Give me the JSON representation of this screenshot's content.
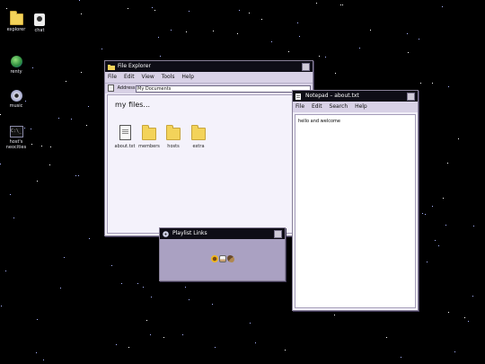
{
  "desktop": {
    "background": "#000000",
    "icons": [
      {
        "label": "explorer",
        "icon": "folder-icon"
      },
      {
        "label": "chat",
        "icon": "chat-icon"
      },
      {
        "label": "renty",
        "icon": "globe-icon"
      },
      {
        "label": "music",
        "icon": "cd-icon"
      },
      {
        "label": "host's neocities",
        "icon": "terminal-icon"
      }
    ]
  },
  "explorer": {
    "title": "File Explorer",
    "menu": [
      "File",
      "Edit",
      "View",
      "Tools",
      "Help"
    ],
    "address_label": "Address",
    "address_value": "My Documents",
    "heading": "my files...",
    "files": [
      {
        "name": "about.txt",
        "icon": "text-file-icon"
      },
      {
        "name": "members",
        "icon": "folder-icon"
      },
      {
        "name": "hosts",
        "icon": "folder-icon"
      },
      {
        "name": "extra",
        "icon": "folder-icon"
      }
    ]
  },
  "notepad": {
    "title": "Notepad – about.txt",
    "menu": [
      "File",
      "Edit",
      "Search",
      "Help"
    ],
    "content": "hello and welcome"
  },
  "playlist": {
    "title": "Playlist Links",
    "links": [
      "playlist-flower-icon",
      "playlist-cup-icon",
      "playlist-bird-icon"
    ]
  },
  "colors": {
    "titlebar": "#0e0d16",
    "menubar": "#d8d1e6",
    "playlist_body": "#aaa1c2",
    "window_bg": "#f1eff8"
  }
}
